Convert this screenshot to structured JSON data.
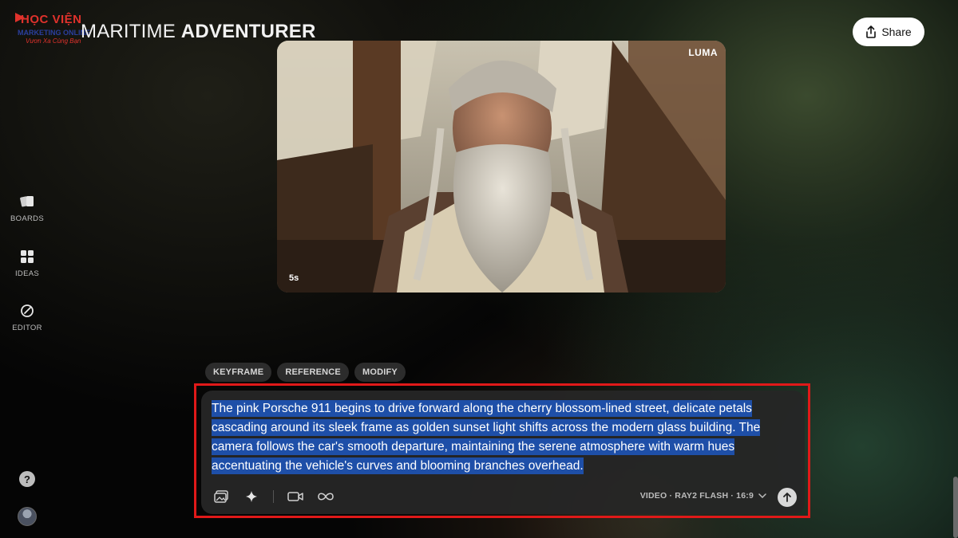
{
  "logo": {
    "top": "HỌC VIỆN",
    "mid": "MARKETING ONLINE",
    "bot": "Vươn Xa Cùng Bạn"
  },
  "header": {
    "title_part1": "MARITIME ",
    "title_part2": "ADVENTURER",
    "share_label": "Share"
  },
  "sidebar": {
    "items": [
      {
        "label": "BOARDS",
        "icon": "boards-icon"
      },
      {
        "label": "IDEAS",
        "icon": "ideas-icon"
      },
      {
        "label": "EDITOR",
        "icon": "editor-icon"
      }
    ],
    "help": "?"
  },
  "video": {
    "watermark": "LUMA",
    "duration": "5s"
  },
  "chips": [
    "KEYFRAME",
    "REFERENCE",
    "MODIFY"
  ],
  "prompt": {
    "text": "The pink Porsche 911 begins to drive forward along the cherry blossom-lined street, delicate petals cascading around its sleek frame as golden sunset light shifts across the modern glass building. The camera follows the car's smooth departure, maintaining the serene atmosphere with warm hues accentuating the vehicle's curves and blooming branches overhead.",
    "model_label": "VIDEO · RAY2 FLASH · 16:9"
  },
  "colors": {
    "selection": "#1e4fa8",
    "highlight_frame": "#e01919",
    "logo_red": "#e0322c",
    "logo_blue": "#2a3f9e"
  }
}
